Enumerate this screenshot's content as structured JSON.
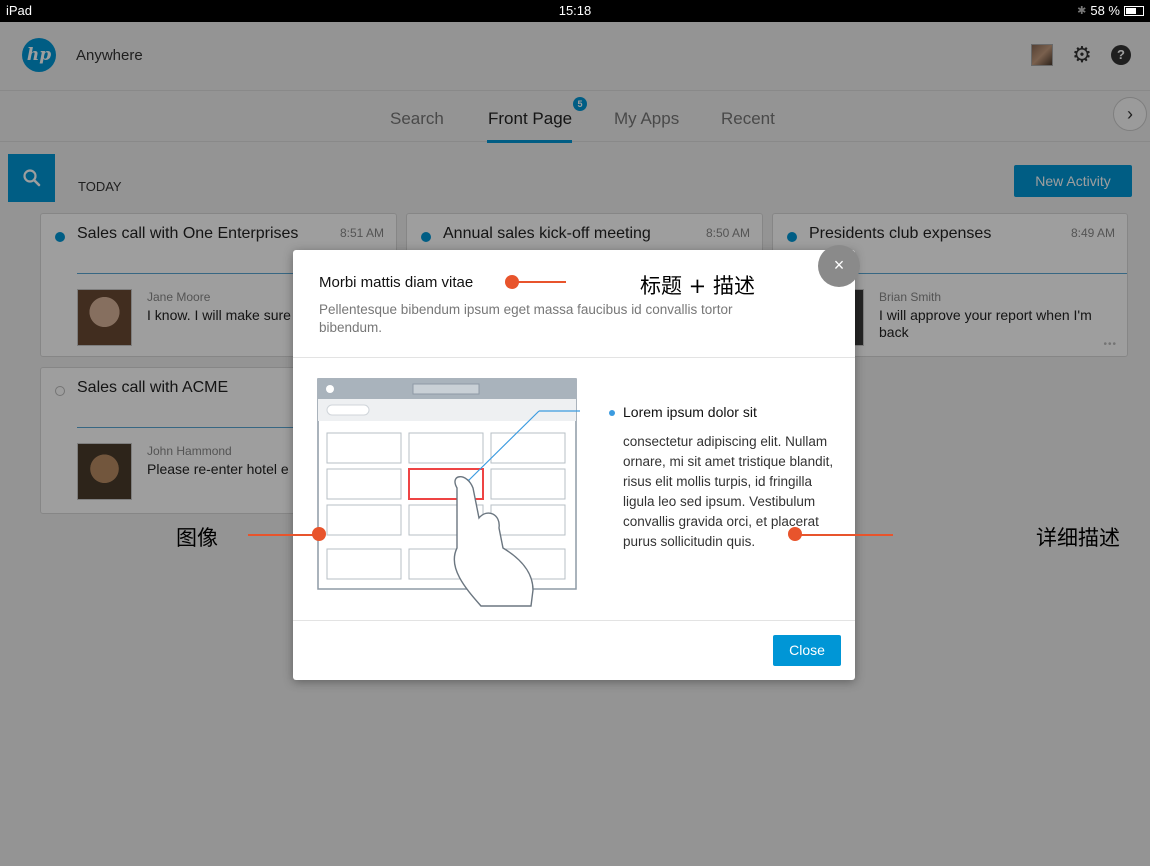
{
  "status_bar": {
    "carrier": "iPad",
    "time": "15:18",
    "battery": "58 %"
  },
  "header": {
    "app_name": "Anywhere",
    "logo_text": "hp"
  },
  "tabs": [
    {
      "label": "Search"
    },
    {
      "label": "Front Page",
      "badge": "5"
    },
    {
      "label": "My Apps"
    },
    {
      "label": "Recent"
    }
  ],
  "section": {
    "title": "TODAY",
    "new_activity_label": "New Activity"
  },
  "cards": [
    {
      "title": "Sales call with One Enterprises",
      "time": "8:51 AM",
      "person": "Jane Moore",
      "message": "I know. I will make sure settled"
    },
    {
      "title": "Annual sales kick-off meeting",
      "time": "8:50 AM"
    },
    {
      "title": "Presidents club expenses",
      "time": "8:49 AM",
      "person": "Brian Smith",
      "message": "I will approve your report when I'm back"
    },
    {
      "title": "Sales call with ACME",
      "person": "John Hammond",
      "message": "Please re-enter hotel e"
    }
  ],
  "modal": {
    "title": "Morbi mattis diam vitae",
    "description": "Pellentesque bibendum ipsum eget massa faucibus id convallis tortor bibendum.",
    "detail_heading": "Lorem ipsum dolor sit",
    "detail_body": "consectetur adipiscing elit. Nullam ornare, mi sit amet tristique blandit, risus elit mollis turpis, id fringilla ligula leo sed ipsum. Vestibulum convallis gravida orci, et placerat purus sollicitudin quis.",
    "close_label": "Close",
    "close_x": "×"
  },
  "annotations": {
    "title_desc": "标题 + 描述",
    "image": "图像",
    "detail": "详细描述"
  },
  "colors": {
    "accent": "#0096d6",
    "annotation": "#e8542c"
  }
}
